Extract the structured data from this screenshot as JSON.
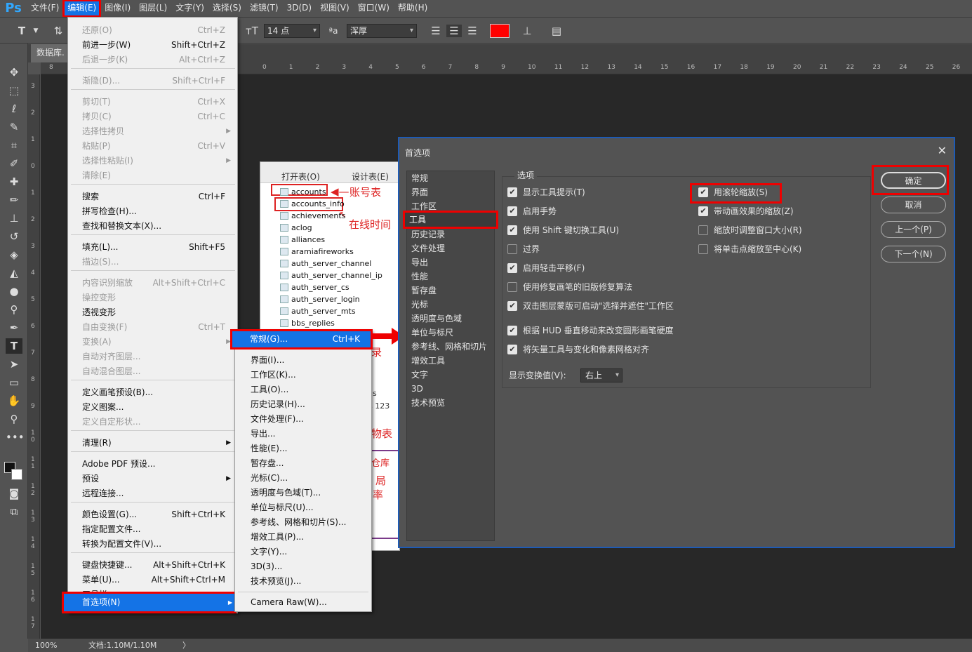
{
  "menubar": {
    "logo": "Ps",
    "items": [
      "文件(F)",
      "编辑(E)",
      "图像(I)",
      "图层(L)",
      "文字(Y)",
      "选择(S)",
      "滤镜(T)",
      "3D(D)",
      "视图(V)",
      "窗口(W)",
      "帮助(H)"
    ]
  },
  "optbar": {
    "font_size": "14 点",
    "aa_icon": "ªa",
    "aa_mode": "浑厚",
    "text_color": "#ff0000"
  },
  "doc_tab": "数据库.",
  "ruler_top": [
    "8",
    "0",
    "1",
    "2",
    "3",
    "4",
    "5",
    "6",
    "7",
    "8",
    "9",
    "10",
    "11",
    "12",
    "13",
    "14",
    "15",
    "16",
    "17",
    "18",
    "19",
    "20",
    "21",
    "22",
    "23",
    "24",
    "25",
    "26"
  ],
  "ruler_left": [
    "3",
    "2",
    "1",
    "0",
    "1",
    "2",
    "3",
    "4",
    "5",
    "6",
    "7",
    "8",
    "9",
    "1 0",
    "1 1",
    "1 2",
    "1 3",
    "1 4",
    "1 5",
    "1 6",
    "1 7"
  ],
  "status": {
    "zoom": "100%",
    "doc": "文档:1.10M/1.10M",
    "arrow": "〉"
  },
  "doc_image": {
    "toolbar_open": "打开表(O)",
    "toolbar_design": "设计表(E)",
    "tables": [
      "accounts",
      "accounts_info",
      "achievements",
      "aclog",
      "alliances",
      "aramiafireworks",
      "auth_server_channel",
      "auth_server_channel_ip",
      "auth_server_cs",
      "auth_server_login",
      "auth_server_mts",
      "bbs_replies"
    ],
    "note_accounts": "账号表",
    "note_online": "在线时间",
    "partial": [
      "录",
      "s",
      "s 123",
      "物表",
      "仓库",
      "局",
      "率"
    ]
  },
  "edit_menu": {
    "items": [
      {
        "label": "还原(O)",
        "sc": "Ctrl+Z",
        "dis": true
      },
      {
        "label": "前进一步(W)",
        "sc": "Shift+Ctrl+Z",
        "dis": false
      },
      {
        "label": "后退一步(K)",
        "sc": "Alt+Ctrl+Z",
        "dis": true
      },
      {
        "label": "渐隐(D)...",
        "sc": "Shift+Ctrl+F",
        "dis": true
      },
      {
        "label": "剪切(T)",
        "sc": "Ctrl+X",
        "dis": true
      },
      {
        "label": "拷贝(C)",
        "sc": "Ctrl+C",
        "dis": true
      },
      {
        "label": "选择性拷贝",
        "sc": "",
        "dis": true,
        "sub": true
      },
      {
        "label": "粘贴(P)",
        "sc": "Ctrl+V",
        "dis": true
      },
      {
        "label": "选择性粘贴(I)",
        "sc": "",
        "dis": true,
        "sub": true
      },
      {
        "label": "清除(E)",
        "sc": "",
        "dis": true
      },
      {
        "label": "搜索",
        "sc": "Ctrl+F",
        "dis": false
      },
      {
        "label": "拼写检查(H)...",
        "sc": "",
        "dis": false
      },
      {
        "label": "查找和替换文本(X)...",
        "sc": "",
        "dis": false
      },
      {
        "label": "填充(L)...",
        "sc": "Shift+F5",
        "dis": false
      },
      {
        "label": "描边(S)...",
        "sc": "",
        "dis": true
      },
      {
        "label": "内容识别缩放",
        "sc": "Alt+Shift+Ctrl+C",
        "dis": true
      },
      {
        "label": "操控变形",
        "sc": "",
        "dis": true
      },
      {
        "label": "透视变形",
        "sc": "",
        "dis": false
      },
      {
        "label": "自由变换(F)",
        "sc": "Ctrl+T",
        "dis": true
      },
      {
        "label": "变换(A)",
        "sc": "",
        "dis": true,
        "sub": true
      },
      {
        "label": "自动对齐图层...",
        "sc": "",
        "dis": true
      },
      {
        "label": "自动混合图层...",
        "sc": "",
        "dis": true
      },
      {
        "label": "定义画笔预设(B)...",
        "sc": "",
        "dis": false
      },
      {
        "label": "定义图案...",
        "sc": "",
        "dis": false
      },
      {
        "label": "定义自定形状...",
        "sc": "",
        "dis": true
      },
      {
        "label": "清理(R)",
        "sc": "",
        "dis": false,
        "sub": true
      },
      {
        "label": "Adobe PDF 预设...",
        "sc": "",
        "dis": false
      },
      {
        "label": "预设",
        "sc": "",
        "dis": false,
        "sub": true
      },
      {
        "label": "远程连接...",
        "sc": "",
        "dis": false
      },
      {
        "label": "颜色设置(G)...",
        "sc": "Shift+Ctrl+K",
        "dis": false
      },
      {
        "label": "指定配置文件...",
        "sc": "",
        "dis": false
      },
      {
        "label": "转换为配置文件(V)...",
        "sc": "",
        "dis": false
      },
      {
        "label": "键盘快捷键...",
        "sc": "Alt+Shift+Ctrl+K",
        "dis": false
      },
      {
        "label": "菜单(U)...",
        "sc": "Alt+Shift+Ctrl+M",
        "dis": false
      },
      {
        "label": "工具栏...",
        "sc": "",
        "dis": false
      }
    ],
    "prefs": "首选项(N)",
    "prefs_arrow": "▶"
  },
  "submenu": {
    "general": "常规(G)...",
    "general_sc": "Ctrl+K",
    "items": [
      "界面(I)...",
      "工作区(K)...",
      "工具(O)...",
      "历史记录(H)...",
      "文件处理(F)...",
      "导出...",
      "性能(E)...",
      "暂存盘...",
      "光标(C)...",
      "透明度与色域(T)...",
      "单位与标尺(U)...",
      "参考线、网格和切片(S)...",
      "增效工具(P)...",
      "文字(Y)...",
      "3D(3)...",
      "技术预览(J)..."
    ],
    "camera_raw": "Camera Raw(W)..."
  },
  "dialog": {
    "title": "首选项",
    "close": "✕",
    "nav": [
      "常规",
      "界面",
      "工作区",
      "工具",
      "历史记录",
      "文件处理",
      "导出",
      "性能",
      "暂存盘",
      "光标",
      "透明度与色域",
      "单位与标尺",
      "参考线、网格和切片",
      "增效工具",
      "文字",
      "3D",
      "技术预览"
    ],
    "legend": "选项",
    "left_opts": [
      {
        "label": "显示工具提示(T)",
        "on": true
      },
      {
        "label": "启用手势",
        "on": true
      },
      {
        "label": "使用 Shift 键切换工具(U)",
        "on": true
      },
      {
        "label": "过界",
        "on": false
      },
      {
        "label": "启用轻击平移(F)",
        "on": true
      },
      {
        "label": "使用修复画笔的旧版修复算法",
        "on": false
      },
      {
        "label": "双击图层蒙版可启动\"选择并遮住\"工作区",
        "on": true
      },
      {
        "label": "根据 HUD 垂直移动来改变圆形画笔硬度",
        "on": true
      },
      {
        "label": "将矢量工具与变化和像素网格对齐",
        "on": true
      }
    ],
    "right_opts": [
      {
        "label": "用滚轮缩放(S)",
        "on": true
      },
      {
        "label": "带动画效果的缩放(Z)",
        "on": true
      },
      {
        "label": "缩放时调整窗口大小(R)",
        "on": false
      },
      {
        "label": "将单击点缩放至中心(K)",
        "on": false
      }
    ],
    "transform_label": "显示变换值(V):",
    "transform_value": "右上",
    "buttons": [
      "确定",
      "取消",
      "上一个(P)",
      "下一个(N)"
    ]
  }
}
